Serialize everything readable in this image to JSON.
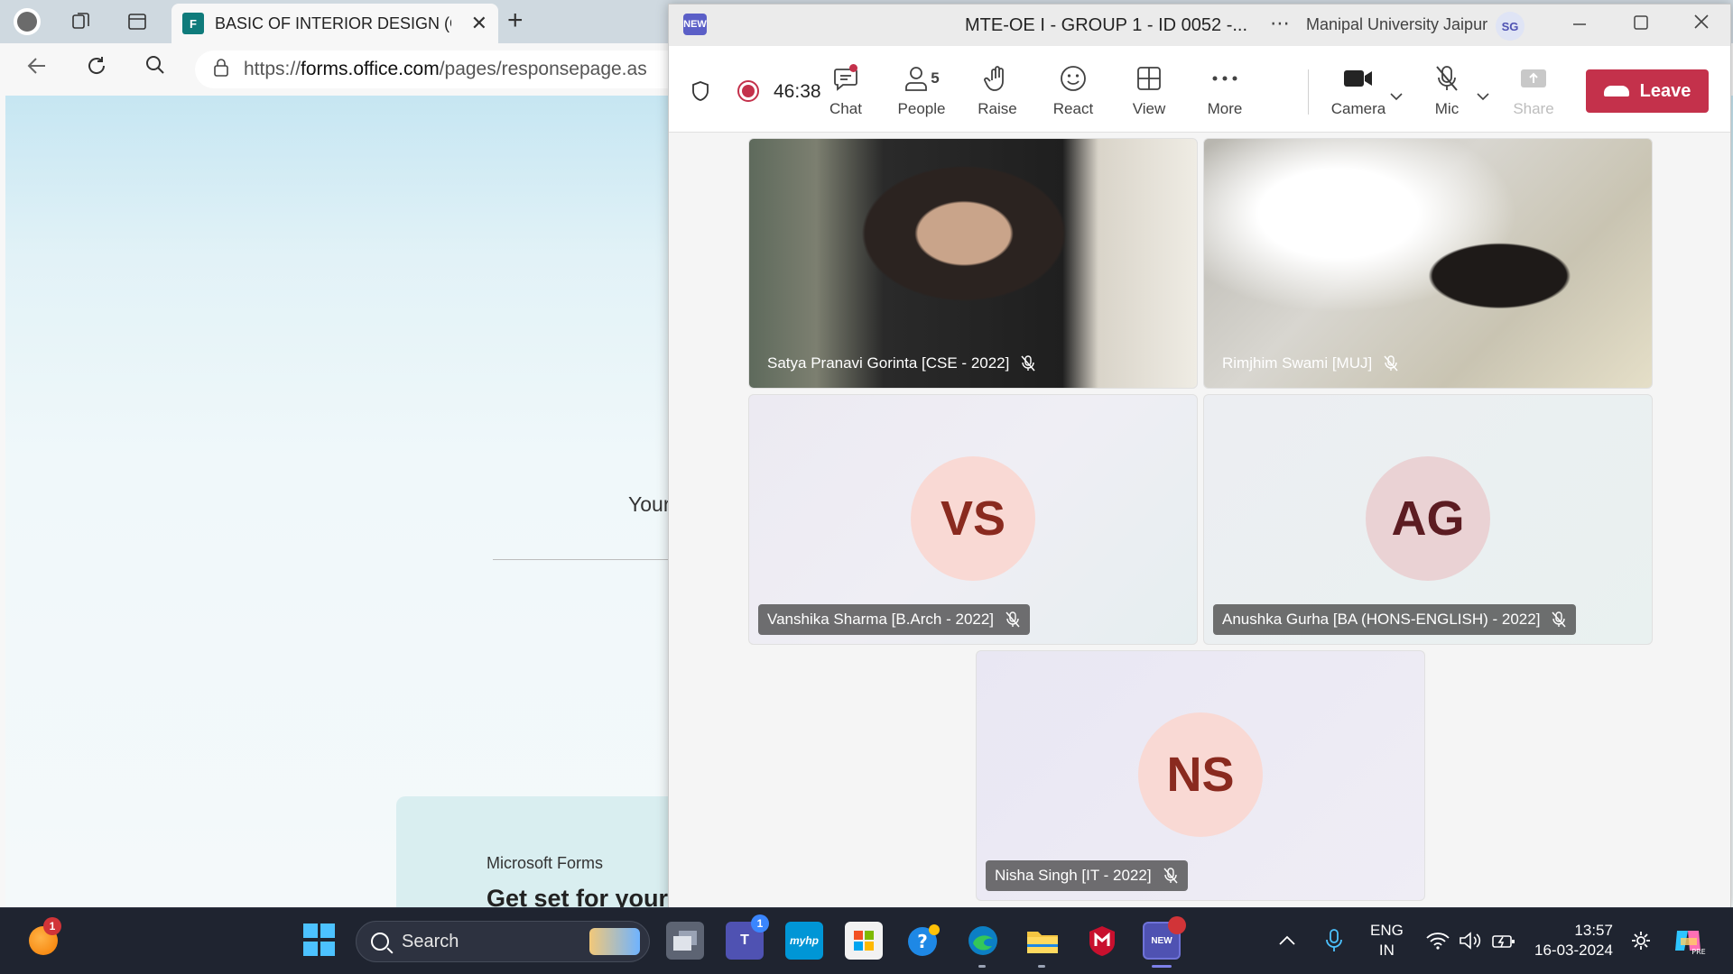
{
  "browser": {
    "tab_title": "BASIC OF INTERIOR DESIGN (OP",
    "url_prefix": "https://",
    "url_domain": "forms.office.com",
    "url_path": "/pages/responsepage.as",
    "page": {
      "partial_text": "Your",
      "promo_brand": "Microsoft Forms",
      "promo_title": "Get set for your own event invitation."
    }
  },
  "teams": {
    "app_badge": "NEW",
    "window_title": "MTE-OE I - GROUP 1 - ID 0052 -...",
    "more_glyph": "⋯",
    "org_name": "Manipal University Jaipur",
    "user_initials": "SG",
    "timer": "46:38",
    "toolbar": {
      "chat": "Chat",
      "people": "People",
      "people_count": "5",
      "raise": "Raise",
      "react": "React",
      "view": "View",
      "more": "More",
      "camera": "Camera",
      "mic": "Mic",
      "share": "Share",
      "leave": "Leave"
    },
    "participants": [
      {
        "name": "Satya Pranavi Gorinta [CSE - 2022]",
        "type": "video",
        "muted": true
      },
      {
        "name": "Rimjhim Swami [MUJ]",
        "type": "video",
        "muted": true
      },
      {
        "name": "Vanshika Sharma [B.Arch - 2022]",
        "initials": "VS",
        "type": "avatar",
        "muted": true,
        "avatar_bg": "#f9d9d4",
        "avatar_fg": "#8a2a1f"
      },
      {
        "name": "Anushka Gurha [BA (HONS-ENGLISH) - 2022]",
        "initials": "AG",
        "type": "avatar",
        "muted": true,
        "avatar_bg": "#ead2d4",
        "avatar_fg": "#5c1c22"
      },
      {
        "name": "Nisha Singh [IT - 2022]",
        "initials": "NS",
        "type": "avatar",
        "muted": true,
        "avatar_bg": "#f9d9d4",
        "avatar_fg": "#8a2a1f"
      }
    ],
    "colors": {
      "leave": "#c4314b",
      "brand": "#5b5fc7"
    }
  },
  "taskbar": {
    "weather_badge": "1",
    "search_placeholder": "Search",
    "teams_badge": "1",
    "myhp_label": "myhp",
    "teams_new_label": "NEW",
    "language": "ENG",
    "region": "IN",
    "time": "13:57",
    "date": "16-03-2024",
    "copilot_label": "PRE"
  }
}
